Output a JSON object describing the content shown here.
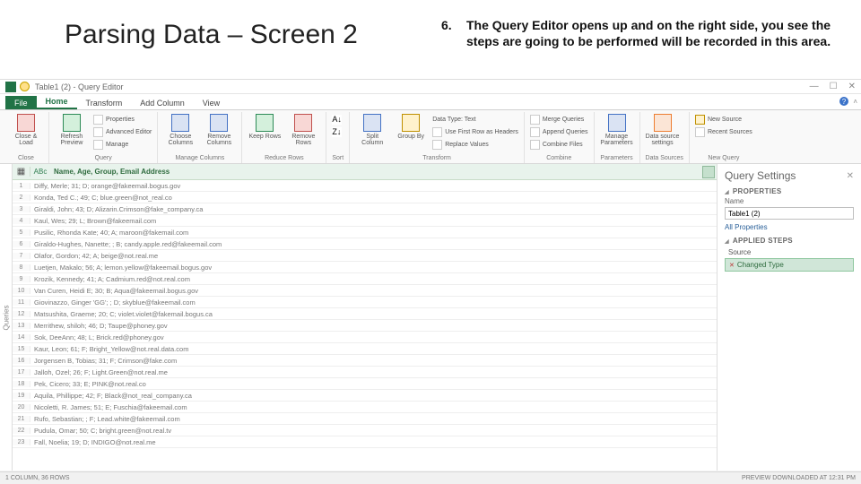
{
  "slide": {
    "title": "Parsing Data – Screen 2",
    "note_num": "6.",
    "note_body": "The Query Editor opens up and on the right side, you see the steps are going to be performed will be recorded in this area."
  },
  "titlebar": {
    "title": "Table1 (2) - Query Editor",
    "min": "—",
    "max": "☐",
    "close": "✕"
  },
  "tabs": {
    "file": "File",
    "home": "Home",
    "transform": "Transform",
    "add": "Add Column",
    "view": "View"
  },
  "ribbon": {
    "close_load": "Close & Load",
    "refresh": "Refresh Preview",
    "properties": "Properties",
    "adv_editor": "Advanced Editor",
    "manage": "Manage",
    "choose_cols": "Choose Columns",
    "remove_cols": "Remove Columns",
    "keep_rows": "Keep Rows",
    "remove_rows": "Remove Rows",
    "sort_asc": "↑",
    "sort_desc": "↓",
    "split": "Split Column",
    "group_by": "Group By",
    "data_type": "Data Type: Text",
    "first_row": "Use First Row as Headers",
    "replace": "Replace Values",
    "merge_q": "Merge Queries",
    "append_q": "Append Queries",
    "combine_f": "Combine Files",
    "manage_params": "Manage Parameters",
    "data_src": "Data source settings",
    "new_src": "New Source",
    "recent_src": "Recent Sources",
    "grp_close": "Close",
    "grp_query": "Query",
    "grp_mcols": "Manage Columns",
    "grp_rrows": "Reduce Rows",
    "grp_sort": "Sort",
    "grp_trans": "Transform",
    "grp_combine": "Combine",
    "grp_params": "Parameters",
    "grp_ds": "Data Sources",
    "grp_nq": "New Query"
  },
  "grid": {
    "left_label": "Queries",
    "col_header": "Name, Age, Group, Email Address",
    "rows": [
      "Diffy, Merle; 31; D; orange@fakeemail.bogus.gov",
      "Konda, Ted C.; 49; C; blue.green@not_real.co",
      "Giraldi, John; 43; D; Alizarin.Crimson@fake_company.ca",
      "Kaul, Wes; 29; L; Brown@fakeemail.com",
      "Pusilic, Rhonda Kate; 40; A; maroon@fakemail.com",
      "Giraldo-Hughes, Nanette; ; B; candy.apple.red@fakeemail.com",
      "Olafor, Gordon; 42; A; beige@not.real.me",
      "Luetjen, Makalo; 56; A; lemon.yellow@fakeemail.bogus.gov",
      "Krozik, Kennedy; 41; A; Cadmium.red@not.real.com",
      "Van Curen, Heidi E; 30; B; Aqua@fakeemail.bogus.gov",
      "Giovinazzo, Ginger 'GG'; ; D; skyblue@fakeemail.com",
      "Matsushita, Graeme; 20; C; violet.violet@fakemail.bogus.ca",
      "Merrithew, shiloh; 46; D; Taupe@phoney.gov",
      "Sok, DeeAnn; 48; L; Brick.red@phoney.gov",
      "Kaur, Leon; 61; F; Bright_Yellow@not.real.data.com",
      "Jorgensen B, Tobias; 31; F; Crimson@fake.com",
      "Jalloh, Ozel; 26; F; Light.Green@not.real.me",
      "Pek, Cicero; 33; E; PINK@not.real.co",
      "Aquila, Phillippe; 42; F; Black@not_real_company.ca",
      "Nicoletti, R. James; 51; E; Fuschia@fakeemail.com",
      "Rufo, Sebastian; ; F; Lead.white@fakeemail.com",
      "Pudula, Omar; 50; C; bright.green@not.real.tv",
      "Fall, Noelia; 19; D; INDIGO@not.real.me"
    ]
  },
  "settings": {
    "title": "Query Settings",
    "sec_props": "PROPERTIES",
    "name_label": "Name",
    "name_value": "Table1 (2)",
    "all_props": "All Properties",
    "sec_steps": "APPLIED STEPS",
    "step_source": "Source",
    "step_changed": "Changed Type"
  },
  "status": {
    "left": "1 COLUMN, 36 ROWS",
    "right": "PREVIEW DOWNLOADED AT 12:31 PM"
  }
}
